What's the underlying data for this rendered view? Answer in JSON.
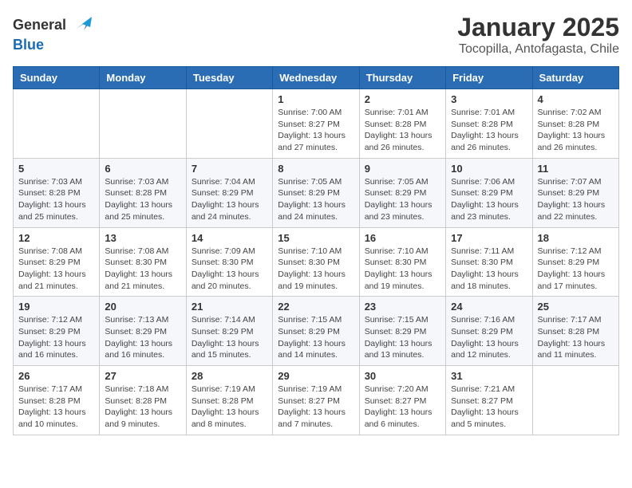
{
  "header": {
    "logo_general": "General",
    "logo_blue": "Blue",
    "month": "January 2025",
    "location": "Tocopilla, Antofagasta, Chile"
  },
  "days_of_week": [
    "Sunday",
    "Monday",
    "Tuesday",
    "Wednesday",
    "Thursday",
    "Friday",
    "Saturday"
  ],
  "weeks": [
    [
      {
        "day": "",
        "sunrise": "",
        "sunset": "",
        "daylight": ""
      },
      {
        "day": "",
        "sunrise": "",
        "sunset": "",
        "daylight": ""
      },
      {
        "day": "",
        "sunrise": "",
        "sunset": "",
        "daylight": ""
      },
      {
        "day": "1",
        "sunrise": "Sunrise: 7:00 AM",
        "sunset": "Sunset: 8:27 PM",
        "daylight": "Daylight: 13 hours and 27 minutes."
      },
      {
        "day": "2",
        "sunrise": "Sunrise: 7:01 AM",
        "sunset": "Sunset: 8:28 PM",
        "daylight": "Daylight: 13 hours and 26 minutes."
      },
      {
        "day": "3",
        "sunrise": "Sunrise: 7:01 AM",
        "sunset": "Sunset: 8:28 PM",
        "daylight": "Daylight: 13 hours and 26 minutes."
      },
      {
        "day": "4",
        "sunrise": "Sunrise: 7:02 AM",
        "sunset": "Sunset: 8:28 PM",
        "daylight": "Daylight: 13 hours and 26 minutes."
      }
    ],
    [
      {
        "day": "5",
        "sunrise": "Sunrise: 7:03 AM",
        "sunset": "Sunset: 8:28 PM",
        "daylight": "Daylight: 13 hours and 25 minutes."
      },
      {
        "day": "6",
        "sunrise": "Sunrise: 7:03 AM",
        "sunset": "Sunset: 8:28 PM",
        "daylight": "Daylight: 13 hours and 25 minutes."
      },
      {
        "day": "7",
        "sunrise": "Sunrise: 7:04 AM",
        "sunset": "Sunset: 8:29 PM",
        "daylight": "Daylight: 13 hours and 24 minutes."
      },
      {
        "day": "8",
        "sunrise": "Sunrise: 7:05 AM",
        "sunset": "Sunset: 8:29 PM",
        "daylight": "Daylight: 13 hours and 24 minutes."
      },
      {
        "day": "9",
        "sunrise": "Sunrise: 7:05 AM",
        "sunset": "Sunset: 8:29 PM",
        "daylight": "Daylight: 13 hours and 23 minutes."
      },
      {
        "day": "10",
        "sunrise": "Sunrise: 7:06 AM",
        "sunset": "Sunset: 8:29 PM",
        "daylight": "Daylight: 13 hours and 23 minutes."
      },
      {
        "day": "11",
        "sunrise": "Sunrise: 7:07 AM",
        "sunset": "Sunset: 8:29 PM",
        "daylight": "Daylight: 13 hours and 22 minutes."
      }
    ],
    [
      {
        "day": "12",
        "sunrise": "Sunrise: 7:08 AM",
        "sunset": "Sunset: 8:29 PM",
        "daylight": "Daylight: 13 hours and 21 minutes."
      },
      {
        "day": "13",
        "sunrise": "Sunrise: 7:08 AM",
        "sunset": "Sunset: 8:30 PM",
        "daylight": "Daylight: 13 hours and 21 minutes."
      },
      {
        "day": "14",
        "sunrise": "Sunrise: 7:09 AM",
        "sunset": "Sunset: 8:30 PM",
        "daylight": "Daylight: 13 hours and 20 minutes."
      },
      {
        "day": "15",
        "sunrise": "Sunrise: 7:10 AM",
        "sunset": "Sunset: 8:30 PM",
        "daylight": "Daylight: 13 hours and 19 minutes."
      },
      {
        "day": "16",
        "sunrise": "Sunrise: 7:10 AM",
        "sunset": "Sunset: 8:30 PM",
        "daylight": "Daylight: 13 hours and 19 minutes."
      },
      {
        "day": "17",
        "sunrise": "Sunrise: 7:11 AM",
        "sunset": "Sunset: 8:30 PM",
        "daylight": "Daylight: 13 hours and 18 minutes."
      },
      {
        "day": "18",
        "sunrise": "Sunrise: 7:12 AM",
        "sunset": "Sunset: 8:29 PM",
        "daylight": "Daylight: 13 hours and 17 minutes."
      }
    ],
    [
      {
        "day": "19",
        "sunrise": "Sunrise: 7:12 AM",
        "sunset": "Sunset: 8:29 PM",
        "daylight": "Daylight: 13 hours and 16 minutes."
      },
      {
        "day": "20",
        "sunrise": "Sunrise: 7:13 AM",
        "sunset": "Sunset: 8:29 PM",
        "daylight": "Daylight: 13 hours and 16 minutes."
      },
      {
        "day": "21",
        "sunrise": "Sunrise: 7:14 AM",
        "sunset": "Sunset: 8:29 PM",
        "daylight": "Daylight: 13 hours and 15 minutes."
      },
      {
        "day": "22",
        "sunrise": "Sunrise: 7:15 AM",
        "sunset": "Sunset: 8:29 PM",
        "daylight": "Daylight: 13 hours and 14 minutes."
      },
      {
        "day": "23",
        "sunrise": "Sunrise: 7:15 AM",
        "sunset": "Sunset: 8:29 PM",
        "daylight": "Daylight: 13 hours and 13 minutes."
      },
      {
        "day": "24",
        "sunrise": "Sunrise: 7:16 AM",
        "sunset": "Sunset: 8:29 PM",
        "daylight": "Daylight: 13 hours and 12 minutes."
      },
      {
        "day": "25",
        "sunrise": "Sunrise: 7:17 AM",
        "sunset": "Sunset: 8:28 PM",
        "daylight": "Daylight: 13 hours and 11 minutes."
      }
    ],
    [
      {
        "day": "26",
        "sunrise": "Sunrise: 7:17 AM",
        "sunset": "Sunset: 8:28 PM",
        "daylight": "Daylight: 13 hours and 10 minutes."
      },
      {
        "day": "27",
        "sunrise": "Sunrise: 7:18 AM",
        "sunset": "Sunset: 8:28 PM",
        "daylight": "Daylight: 13 hours and 9 minutes."
      },
      {
        "day": "28",
        "sunrise": "Sunrise: 7:19 AM",
        "sunset": "Sunset: 8:28 PM",
        "daylight": "Daylight: 13 hours and 8 minutes."
      },
      {
        "day": "29",
        "sunrise": "Sunrise: 7:19 AM",
        "sunset": "Sunset: 8:27 PM",
        "daylight": "Daylight: 13 hours and 7 minutes."
      },
      {
        "day": "30",
        "sunrise": "Sunrise: 7:20 AM",
        "sunset": "Sunset: 8:27 PM",
        "daylight": "Daylight: 13 hours and 6 minutes."
      },
      {
        "day": "31",
        "sunrise": "Sunrise: 7:21 AM",
        "sunset": "Sunset: 8:27 PM",
        "daylight": "Daylight: 13 hours and 5 minutes."
      },
      {
        "day": "",
        "sunrise": "",
        "sunset": "",
        "daylight": ""
      }
    ]
  ]
}
